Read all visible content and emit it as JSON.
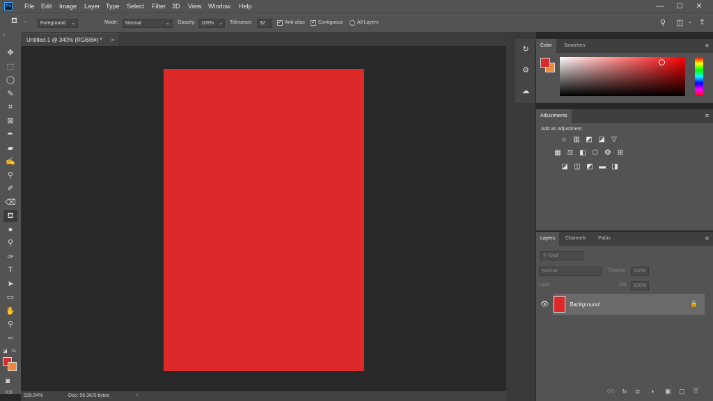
{
  "app": {
    "logo": "Ps"
  },
  "menu": [
    "File",
    "Edit",
    "Image",
    "Layer",
    "Type",
    "Select",
    "Filter",
    "3D",
    "View",
    "Window",
    "Help"
  ],
  "window_controls": {
    "minimize": "—",
    "maximize": "☐",
    "close": "✕"
  },
  "options": {
    "fill_source": "Foreground",
    "mode_label": "Mode:",
    "mode_value": "Normal",
    "opacity_label": "Opacity:",
    "opacity_value": "100%",
    "tolerance_label": "Tolerance:",
    "tolerance_value": "32",
    "antialias_label": "Anti-alias",
    "antialias_checked": true,
    "contiguous_label": "Contiguous",
    "contiguous_checked": true,
    "all_layers_label": "All Layers",
    "all_layers_checked": false
  },
  "document": {
    "tab_title": "Untitled-1 @ 340% (RGB/8#) *",
    "tab_close": "×",
    "fill_color": "#dc2a2a",
    "zoom": "339.54%",
    "doc_info": "Doc: 56.3K/0 bytes",
    "status_arrow": "›"
  },
  "tools": [
    {
      "name": "move-tool-icon",
      "glyph": "✥"
    },
    {
      "name": "marquee-tool-icon",
      "glyph": "⬚"
    },
    {
      "name": "lasso-tool-icon",
      "glyph": "◯"
    },
    {
      "name": "quick-select-tool-icon",
      "glyph": "✎"
    },
    {
      "name": "crop-tool-icon",
      "glyph": "⌗"
    },
    {
      "name": "frame-tool-icon",
      "glyph": "⊠"
    },
    {
      "name": "eyedropper-tool-icon",
      "glyph": "✒"
    },
    {
      "name": "healing-brush-tool-icon",
      "glyph": "▰"
    },
    {
      "name": "brush-tool-icon",
      "glyph": "✍"
    },
    {
      "name": "clone-stamp-tool-icon",
      "glyph": "⚲"
    },
    {
      "name": "history-brush-tool-icon",
      "glyph": "✐"
    },
    {
      "name": "eraser-tool-icon",
      "glyph": "⌫"
    },
    {
      "name": "paint-bucket-tool-icon",
      "glyph": "⛾",
      "active": true
    },
    {
      "name": "blur-tool-icon",
      "glyph": "●"
    },
    {
      "name": "dodge-tool-icon",
      "glyph": "⚲"
    },
    {
      "name": "pen-tool-icon",
      "glyph": "✑"
    },
    {
      "name": "type-tool-icon",
      "glyph": "T"
    },
    {
      "name": "path-select-tool-icon",
      "glyph": "➤"
    },
    {
      "name": "rectangle-tool-icon",
      "glyph": "▭"
    },
    {
      "name": "hand-tool-icon",
      "glyph": "✋"
    },
    {
      "name": "zoom-tool-icon",
      "glyph": "⚲"
    },
    {
      "name": "more-tools-icon",
      "glyph": "•••"
    }
  ],
  "colors": {
    "foreground": "#d92b2b",
    "background": "#f0883c",
    "panel_bg": "#535353",
    "app_bg": "#282828"
  },
  "color_panel": {
    "tabs": [
      "Color",
      "Swatches"
    ]
  },
  "adjustments_panel": {
    "tab": "Adjustments",
    "hint": "Add an adjustment",
    "row1": [
      "☼",
      "▥",
      "◩",
      "◪",
      "▽"
    ],
    "row2": [
      "▦",
      "⚖",
      "◧",
      "⬡",
      "❂",
      "⊞"
    ],
    "row3": [
      "◪",
      "◫",
      "◩",
      "▬",
      "◨"
    ]
  },
  "layers_panel": {
    "tabs": [
      "Layers",
      "Channels",
      "Paths"
    ],
    "filter_placeholder": "Kind",
    "blend_mode": "Normal",
    "opacity_label": "Opacity:",
    "opacity_value": "100%",
    "lock_label": "Lock:",
    "fill_label": "Fill:",
    "fill_value": "100%",
    "layer_name": "Background",
    "footer_icons": [
      "GO",
      "fx",
      "◘",
      "◑",
      "▣",
      "▢",
      "🗑"
    ]
  }
}
